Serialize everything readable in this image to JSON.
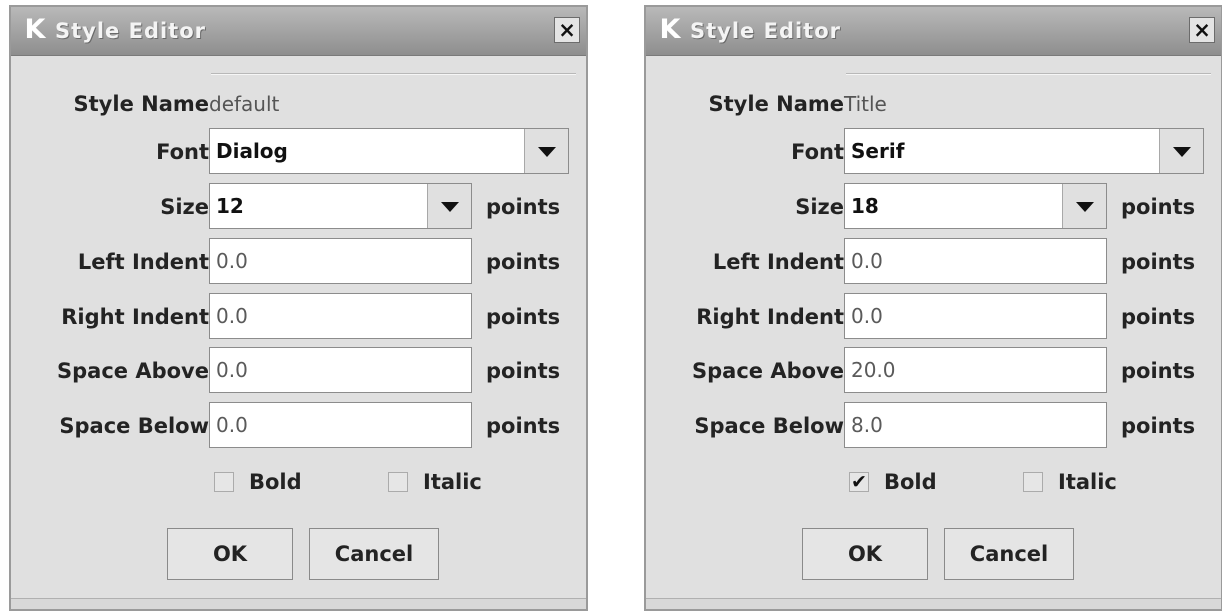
{
  "dialogs": [
    {
      "title": "Style Editor",
      "close": "×",
      "app_icon": "K",
      "style_name_label": "Style Name",
      "style_name_value": "default",
      "font_label": "Font",
      "font_value": "Dialog",
      "size_label": "Size",
      "size_value": "12",
      "size_unit": "points",
      "left_indent_label": "Left Indent",
      "left_indent_value": "0.0",
      "left_indent_unit": "points",
      "right_indent_label": "Right Indent",
      "right_indent_value": "0.0",
      "right_indent_unit": "points",
      "space_above_label": "Space Above",
      "space_above_value": "0.0",
      "space_above_unit": "points",
      "space_below_label": "Space Below",
      "space_below_value": "0.0",
      "space_below_unit": "points",
      "bold_label": "Bold",
      "bold_mark": "",
      "italic_label": "Italic",
      "italic_mark": "",
      "ok_label": "OK",
      "cancel_label": "Cancel"
    },
    {
      "title": "Style Editor",
      "close": "×",
      "app_icon": "K",
      "style_name_label": "Style Name",
      "style_name_value": "Title",
      "font_label": "Font",
      "font_value": "Serif",
      "size_label": "Size",
      "size_value": "18",
      "size_unit": "points",
      "left_indent_label": "Left Indent",
      "left_indent_value": "0.0",
      "left_indent_unit": "points",
      "right_indent_label": "Right Indent",
      "right_indent_value": "0.0",
      "right_indent_unit": "points",
      "space_above_label": "Space Above",
      "space_above_value": "20.0",
      "space_above_unit": "points",
      "space_below_label": "Space Below",
      "space_below_value": "8.0",
      "space_below_unit": "points",
      "bold_label": "Bold",
      "bold_mark": "✔",
      "italic_label": "Italic",
      "italic_mark": "",
      "ok_label": "OK",
      "cancel_label": "Cancel"
    }
  ],
  "icons": {
    "app": "k-app-icon",
    "close": "close-icon",
    "dropdown": "chevron-down-icon"
  }
}
